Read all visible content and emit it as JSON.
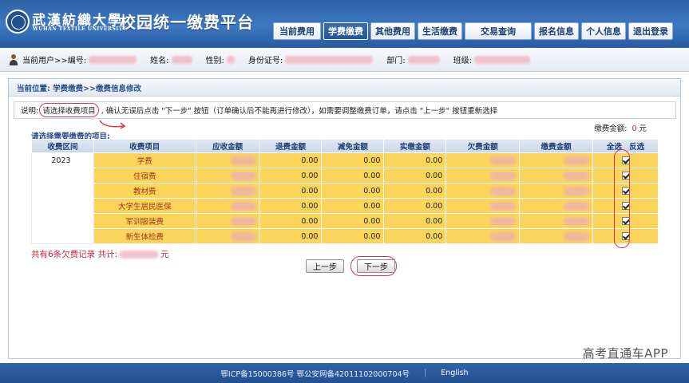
{
  "header": {
    "school_cn": "武漢紡織大學",
    "school_en": "WUHAN TEXTILE UNIVERSITY",
    "site_title": "校园统一缴费平台",
    "nav": [
      {
        "label": "当前费用",
        "active": false
      },
      {
        "label": "学费缴费",
        "active": true
      },
      {
        "label": "其他费用",
        "active": false
      },
      {
        "label": "生活缴费",
        "active": false
      },
      {
        "label": "交易查询",
        "active": false
      },
      {
        "label": "报名信息",
        "active": false
      },
      {
        "label": "个人信息",
        "active": false
      },
      {
        "label": "退出登录",
        "active": false
      }
    ]
  },
  "userbar": {
    "current_user": "当前用户>>编号:",
    "name_label": "姓名:",
    "gender_label": "性别:",
    "id_label": "身份证号:",
    "dept_label": "部门:",
    "class_label": "班级:"
  },
  "breadcrumb": "当前位置: 学费缴费>>缴费信息修改",
  "note": {
    "prefix": "说明:",
    "highlight": "请选择收费项目",
    "rest": ", 确认无误后点击 \"下一步\" 按钮（订单确认后不能再进行修改），如需要调整缴费订单，请点击 \"上一步\" 按钮重新选择"
  },
  "payment_total": {
    "label": "缴费金额:",
    "value": "0",
    "unit": "元"
  },
  "select_title": "请选择需要缴费的项目:",
  "table": {
    "headers": [
      "收费区间",
      "收费项目",
      "应收金额",
      "退费金额",
      "减免金额",
      "实缴金额",
      "欠费金额",
      "缴费金额",
      "全选",
      "反选"
    ],
    "year": "2023",
    "rows": [
      {
        "item": "学费",
        "refund": "0.00",
        "waived": "0.00",
        "paid": "0.00",
        "checked": true
      },
      {
        "item": "住宿费",
        "refund": "0.00",
        "waived": "0.00",
        "paid": "0.00",
        "checked": true
      },
      {
        "item": "教材费",
        "refund": "0.00",
        "waived": "0.00",
        "paid": "0.00",
        "checked": true
      },
      {
        "item": "大学生居民医保",
        "refund": "0.00",
        "waived": "0.00",
        "paid": "0.00",
        "checked": true
      },
      {
        "item": "军训服装费",
        "refund": "0.00",
        "waived": "0.00",
        "paid": "0.00",
        "checked": true
      },
      {
        "item": "新生体检费",
        "refund": "0.00",
        "waived": "0.00",
        "paid": "0.00",
        "checked": true
      }
    ]
  },
  "summary": {
    "prefix": "共有6条欠费记录  共计:",
    "unit": "元"
  },
  "buttons": {
    "prev": "上一步",
    "next": "下一步"
  },
  "watermark": "高考直通车APP",
  "footer": {
    "icp": "鄂ICP备15000386号 鄂公安网备42011102000704号",
    "sep": "|",
    "lang": "English"
  }
}
